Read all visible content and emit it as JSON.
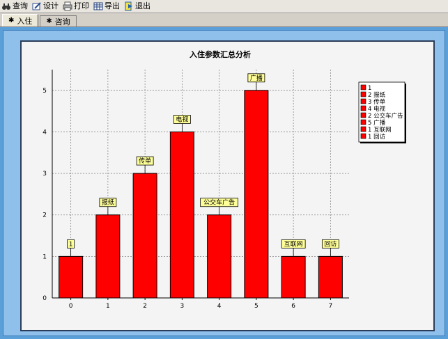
{
  "toolbar": {
    "items": [
      {
        "label": "查询",
        "icon": "binoculars-icon"
      },
      {
        "label": "设计",
        "icon": "design-icon"
      },
      {
        "label": "打印",
        "icon": "printer-icon"
      },
      {
        "label": "导出",
        "icon": "export-grid-icon"
      },
      {
        "label": "退出",
        "icon": "exit-icon"
      }
    ]
  },
  "tabs": [
    {
      "label": "入住",
      "active": true
    },
    {
      "label": "咨询",
      "active": false
    }
  ],
  "colors": {
    "bar": "#ff0000",
    "bar_stroke": "#000000",
    "label_bg": "#ffff99",
    "background": "#5a9fd8"
  },
  "chart_data": {
    "type": "bar",
    "title": "入住参数汇总分析",
    "categories": [
      "0",
      "1",
      "2",
      "3",
      "4",
      "5",
      "6",
      "7"
    ],
    "values": [
      1,
      2,
      3,
      4,
      2,
      5,
      1,
      1
    ],
    "data_labels": [
      "1",
      "报纸",
      "传单",
      "电视",
      "公交车广告",
      "广播",
      "互联网",
      "回访"
    ],
    "ylim": [
      0,
      5.5
    ],
    "yticks": [
      0,
      1,
      2,
      3,
      4,
      5
    ],
    "grid": true,
    "legend": {
      "placement": "right",
      "entries": [
        "1",
        "2 报纸",
        "3 传单",
        "4 电视",
        "2 公交车广告",
        "5 广播",
        "1 互联网",
        "1 回访"
      ]
    }
  }
}
